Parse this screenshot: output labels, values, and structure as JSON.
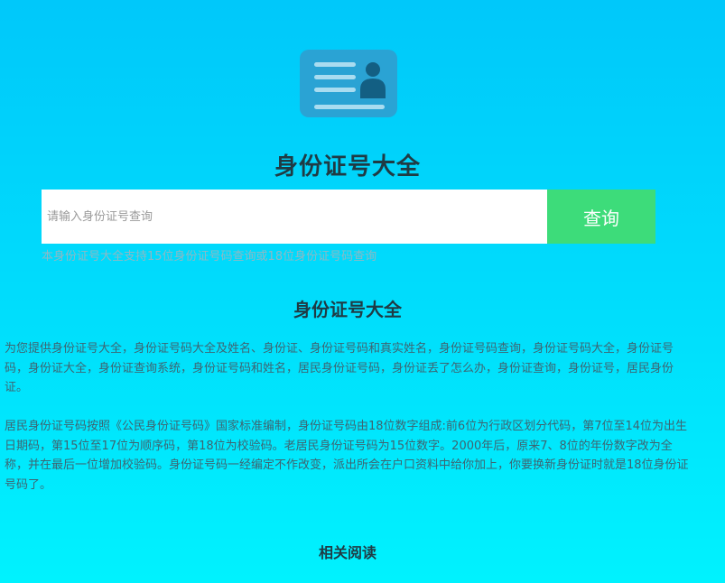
{
  "header": {
    "logo_icon": "id-card-icon",
    "site_title": "身份证号大全"
  },
  "search": {
    "placeholder": "请输入身份证号查询",
    "button_label": "查询",
    "hint": "本身份证号大全支持15位身份证号码查询或18位身份证号码查询"
  },
  "content": {
    "heading": "身份证号大全",
    "paragraph1": "为您提供身份证号大全，身份证号码大全及姓名、身份证、身份证号码和真实姓名，身份证号码查询，身份证号码大全，身份证号码，身份证大全，身份证查询系统，身份证号码和姓名，居民身份证号码，身份证丢了怎么办，身份证查询，身份证号，居民身份证。",
    "paragraph2": "居民身份证号码按照《公民身份证号码》国家标准编制，身份证号码由18位数字组成:前6位为行政区划分代码，第7位至14位为出生日期码，第15位至17位为顺序码，第18位为校验码。老居民身份证号码为15位数字。2000年后，原来7、8位的年份数字改为全称，并在最后一位增加校验码。身份证号码一经编定不作改变，派出所会在户口资料中给你加上，你要换新身份证时就是18位身份证号码了。",
    "related_heading": "相关阅读"
  },
  "colors": {
    "background_top": "#00c8fa",
    "background_bottom": "#00f2fe",
    "logo_bg": "#2aa3d4",
    "button_bg": "#3ddc7a"
  }
}
